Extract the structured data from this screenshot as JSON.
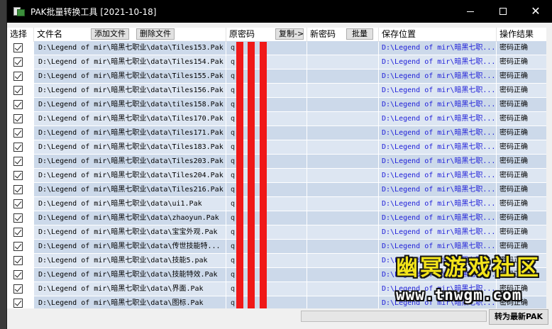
{
  "window": {
    "title": "PAK批量转换工具 [2021-10-18]",
    "minimize_glyph": "",
    "close_glyph": "✕"
  },
  "columns": {
    "select": "选择",
    "file_name": "文件名",
    "add_file": "添加文件",
    "delete_file": "删除文件",
    "orig_password": "原密码",
    "copy": "复制->",
    "new_password": "新密码",
    "batch": "批量",
    "save_location": "保存位置",
    "result": "操作结果"
  },
  "rows": [
    {
      "checked": true,
      "file": "D:\\Legend of mir\\暗黑七职业\\data\\Tiles153.Pak",
      "password": "q      8  2",
      "path": "D:\\Legend of mir\\暗黑七职...",
      "result": "密码正确"
    },
    {
      "checked": true,
      "file": "D:\\Legend of mir\\暗黑七职业\\data\\Tiles154.Pak",
      "password": "q      8  2",
      "path": "D:\\Legend of mir\\暗黑七职...",
      "result": "密码正确"
    },
    {
      "checked": true,
      "file": "D:\\Legend of mir\\暗黑七职业\\data\\Tiles155.Pak",
      "password": "q      8  2",
      "path": "D:\\Legend of mir\\暗黑七职...",
      "result": "密码正确"
    },
    {
      "checked": true,
      "file": "D:\\Legend of mir\\暗黑七职业\\data\\Tiles156.Pak",
      "password": "q      8  2",
      "path": "D:\\Legend of mir\\暗黑七职...",
      "result": "密码正确"
    },
    {
      "checked": true,
      "file": "D:\\Legend of mir\\暗黑七职业\\data\\tiles158.Pak",
      "password": "q      8  2",
      "path": "D:\\Legend of mir\\暗黑七职...",
      "result": "密码正确"
    },
    {
      "checked": true,
      "file": "D:\\Legend of mir\\暗黑七职业\\data\\Tiles170.Pak",
      "password": "q      8  2",
      "path": "D:\\Legend of mir\\暗黑七职...",
      "result": "密码正确"
    },
    {
      "checked": true,
      "file": "D:\\Legend of mir\\暗黑七职业\\data\\Tiles171.Pak",
      "password": "q      8  2",
      "path": "D:\\Legend of mir\\暗黑七职...",
      "result": "密码正确"
    },
    {
      "checked": true,
      "file": "D:\\Legend of mir\\暗黑七职业\\data\\Tiles183.Pak",
      "password": "q      8  2",
      "path": "D:\\Legend of mir\\暗黑七职...",
      "result": "密码正确"
    },
    {
      "checked": true,
      "file": "D:\\Legend of mir\\暗黑七职业\\data\\Tiles203.Pak",
      "password": "q      8  2",
      "path": "D:\\Legend of mir\\暗黑七职...",
      "result": "密码正确"
    },
    {
      "checked": true,
      "file": "D:\\Legend of mir\\暗黑七职业\\data\\Tiles204.Pak",
      "password": "q      8  2",
      "path": "D:\\Legend of mir\\暗黑七职...",
      "result": "密码正确"
    },
    {
      "checked": true,
      "file": "D:\\Legend of mir\\暗黑七职业\\data\\Tiles216.Pak",
      "password": "q      8  2",
      "path": "D:\\Legend of mir\\暗黑七职...",
      "result": "密码正确"
    },
    {
      "checked": true,
      "file": "D:\\Legend of mir\\暗黑七职业\\data\\ui1.Pak",
      "password": "q      8  2",
      "path": "D:\\Legend of mir\\暗黑七职...",
      "result": "密码正确"
    },
    {
      "checked": true,
      "file": "D:\\Legend of mir\\暗黑七职业\\data\\zhaoyun.Pak",
      "password": "q      8  2",
      "path": "D:\\Legend of mir\\暗黑七职...",
      "result": "密码正确"
    },
    {
      "checked": true,
      "file": "D:\\Legend of mir\\暗黑七职业\\data\\宝宝外观.Pak",
      "password": "q      8  2",
      "path": "D:\\Legend of mir\\暗黑七职...",
      "result": "密码正确"
    },
    {
      "checked": true,
      "file": "D:\\Legend of mir\\暗黑七职业\\data\\传世技能特...",
      "password": "q      8  2",
      "path": "D:\\Legend of mir\\暗黑七职...",
      "result": "密码正确"
    },
    {
      "checked": true,
      "file": "D:\\Legend of mir\\暗黑七职业\\data\\技能5.pak",
      "password": "q      8  2",
      "path": "D:\\Legend of mir\\暗黑七职...",
      "result": "密码正确"
    },
    {
      "checked": true,
      "file": "D:\\Legend of mir\\暗黑七职业\\data\\技能特效.Pak",
      "password": "q      8  2",
      "path": "D:\\Legend of mir\\暗黑七职...",
      "result": "密码正确"
    },
    {
      "checked": true,
      "file": "D:\\Legend of mir\\暗黑七职业\\data\\界面.Pak",
      "password": "q      8  2",
      "path": "D:\\Legend of mir\\暗黑七职...",
      "result": "密码正确"
    },
    {
      "checked": true,
      "file": "D:\\Legend of mir\\暗黑七职业\\data\\图标.Pak",
      "password": "q      8  2",
      "path": "D:\\Legend of mir\\暗黑七职...",
      "result": "密码正确"
    }
  ],
  "footer": {
    "convert_button": "转为最新PAK"
  },
  "watermark": {
    "line1": "幽冥游戏社区",
    "line2": "www.tnwgm.com"
  },
  "colors": {
    "row_odd": "#ccd9ea",
    "row_even": "#dde6f2",
    "path_text": "#1d1dd8",
    "redaction": "#f01818",
    "watermark_yellow": "#f3e41a"
  }
}
